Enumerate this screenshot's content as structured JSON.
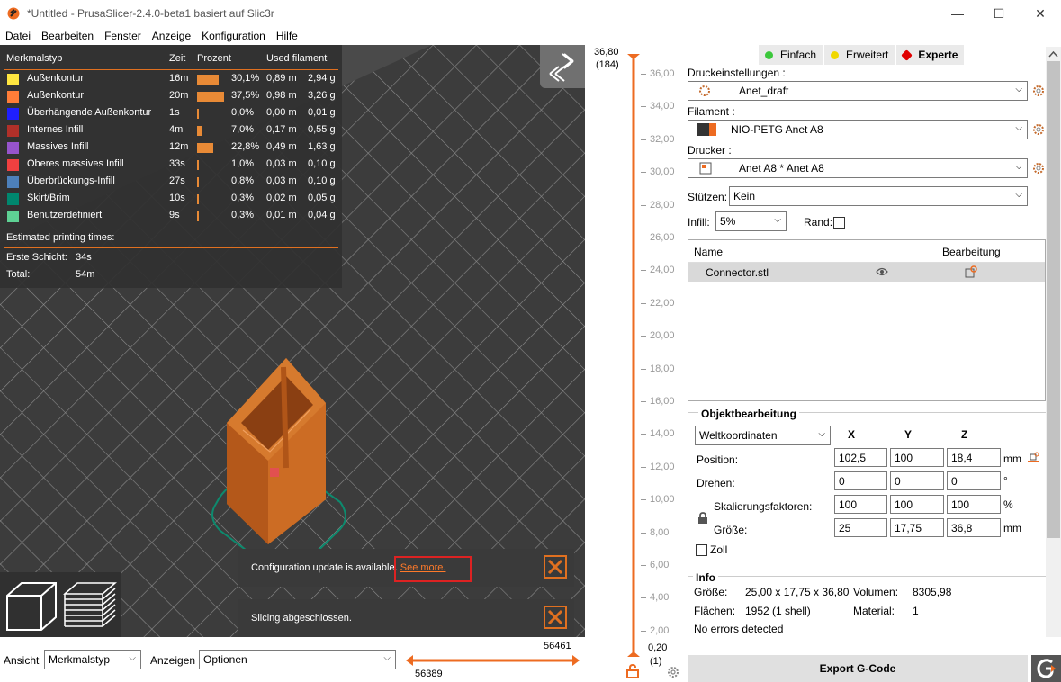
{
  "window": {
    "title": "*Untitled - PrusaSlicer-2.4.0-beta1 basiert auf Slic3r",
    "minimize": "—",
    "maximize": "☐",
    "close": "✕"
  },
  "menu": [
    "Datei",
    "Bearbeiten",
    "Fenster",
    "Anzeige",
    "Konfiguration",
    "Hilfe"
  ],
  "legend": {
    "headers": {
      "type": "Merkmalstyp",
      "time": "Zeit",
      "percent": "Prozent",
      "filament": "Used filament"
    },
    "rows": [
      {
        "color": "#ffe640",
        "name": "Außenkontur",
        "time": "16m",
        "percent": "30,1%",
        "pct_value": 30.1,
        "m": "0,89 m",
        "g": "2,94 g"
      },
      {
        "color": "#ff7d38",
        "name": "Außenkontur",
        "time": "20m",
        "percent": "37,5%",
        "pct_value": 37.5,
        "m": "0,98 m",
        "g": "3,26 g"
      },
      {
        "color": "#1f1fff",
        "name": "Überhängende Außenkontur",
        "time": "1s",
        "percent": "0,0%",
        "pct_value": 0.0,
        "m": "0,00 m",
        "g": "0,01 g"
      },
      {
        "color": "#b03029",
        "name": "Internes Infill",
        "time": "4m",
        "percent": "7,0%",
        "pct_value": 7.0,
        "m": "0,17 m",
        "g": "0,55 g"
      },
      {
        "color": "#9654cc",
        "name": "Massives Infill",
        "time": "12m",
        "percent": "22,8%",
        "pct_value": 22.8,
        "m": "0,49 m",
        "g": "1,63 g"
      },
      {
        "color": "#f04040",
        "name": "Oberes massives Infill",
        "time": "33s",
        "percent": "1,0%",
        "pct_value": 1.0,
        "m": "0,03 m",
        "g": "0,10 g"
      },
      {
        "color": "#4d80ba",
        "name": "Überbrückungs-Infill",
        "time": "27s",
        "percent": "0,8%",
        "pct_value": 0.8,
        "m": "0,03 m",
        "g": "0,10 g"
      },
      {
        "color": "#00876e",
        "name": "Skirt/Brim",
        "time": "10s",
        "percent": "0,3%",
        "pct_value": 0.3,
        "m": "0,02 m",
        "g": "0,05 g"
      },
      {
        "color": "#5ed194",
        "name": "Benutzerdefiniert",
        "time": "9s",
        "percent": "0,3%",
        "pct_value": 0.3,
        "m": "0,01 m",
        "g": "0,04 g"
      }
    ],
    "estimated_title": "Estimated printing times:",
    "first_layer_label": "Erste Schicht:",
    "first_layer_value": "34s",
    "total_label": "Total:",
    "total_value": "54m"
  },
  "notifications": {
    "config_text": "Configuration update is available.",
    "config_link": "See more.",
    "slicing_text": "Slicing abgeschlossen."
  },
  "bottombar": {
    "view_label": "Ansicht",
    "view_value": "Merkmalstyp",
    "show_label": "Anzeigen",
    "show_value": "Optionen",
    "hslider_top": "56461",
    "hslider_bottom": "56389"
  },
  "vslider": {
    "top_value": "36,80",
    "top_index": "(184)",
    "bottom_value": "0,20",
    "bottom_index": "(1)",
    "ticks": [
      "36,00",
      "34,00",
      "32,00",
      "30,00",
      "28,00",
      "26,00",
      "24,00",
      "22,00",
      "20,00",
      "18,00",
      "16,00",
      "14,00",
      "12,00",
      "10,00",
      "8,00",
      "6,00",
      "4,00",
      "2,00"
    ]
  },
  "modes": [
    {
      "label": "Einfach",
      "color": "#3cc83c"
    },
    {
      "label": "Erweitert",
      "color": "#f0d800"
    },
    {
      "label": "Experte",
      "color": "#e00000"
    }
  ],
  "settings": {
    "print_label": "Druckeinstellungen :",
    "print_value": "Anet_draft",
    "filament_label": "Filament :",
    "filament_value": "NIO-PETG Anet A8",
    "printer_label": "Drucker :",
    "printer_value": "Anet A8 * Anet A8",
    "supports_label": "Stützen:",
    "supports_value": "Kein",
    "infill_label": "Infill:",
    "infill_value": "5%",
    "brim_label": "Rand:"
  },
  "objects": {
    "col_name": "Name",
    "col_edit": "Bearbeitung",
    "items": [
      {
        "name": "Connector.stl"
      }
    ]
  },
  "object_manip": {
    "title": "Objektbearbeitung",
    "coord_value": "Weltkoordinaten",
    "x": "X",
    "y": "Y",
    "z": "Z",
    "position_label": "Position:",
    "position": [
      "102,5",
      "100",
      "18,4"
    ],
    "position_unit": "mm",
    "rotation_label": "Drehen:",
    "rotation": [
      "0",
      "0",
      "0"
    ],
    "rotation_unit": "°",
    "scale_label": "Skalierungsfaktoren:",
    "scale": [
      "100",
      "100",
      "100"
    ],
    "scale_unit": "%",
    "size_label": "Größe:",
    "size": [
      "25",
      "17,75",
      "36,8"
    ],
    "size_unit": "mm",
    "inch_label": "Zoll"
  },
  "info": {
    "title": "Info",
    "size_label": "Größe:",
    "size_value": "25,00 x 17,75 x 36,80",
    "volume_label": "Volumen:",
    "volume_value": "8305,98",
    "faces_label": "Flächen:",
    "faces_value": "1952 (1 shell)",
    "material_label": "Material:",
    "material_value": "1",
    "errors": "No errors detected"
  },
  "export_label": "Export G-Code"
}
